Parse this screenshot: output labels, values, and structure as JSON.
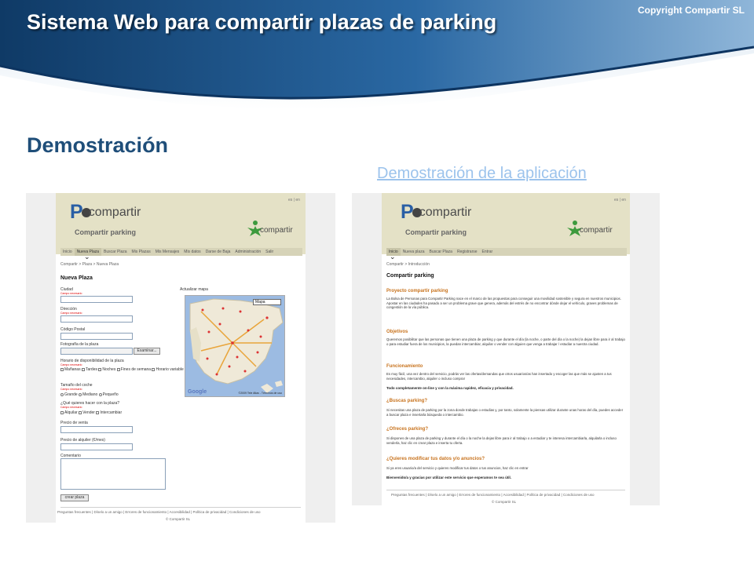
{
  "slide": {
    "title": "Sistema Web para compartir plazas de parking",
    "copyright": "Copyright Compartir SL",
    "section_title": "Demostración",
    "demo_link": "Demostración de la aplicación",
    "colors": {
      "header_dark": "#14416e",
      "header_mid": "#2d6aa4",
      "title_blue": "#1f4e79",
      "link": "#9cc3ec"
    }
  },
  "app": {
    "lang": "es | en",
    "logo_letter": "P",
    "logo_word": "compartir",
    "tagline": "Compartir parking",
    "brand_word": "compartir",
    "footer_links": "Preguntas frecuentes | Díselo a un amigo | Errores de funcionamiento | Accesibilidad | Política de privacidad | Condiciones de uso",
    "footer_copy": "© Compartir SL"
  },
  "left_screen": {
    "nav": [
      "Inicio",
      "Nueva Plaza",
      "Buscar Plaza",
      "Mis Plazas",
      "Mis Mensajes",
      "Mis datos",
      "Darse de Baja",
      "Administración",
      "Salir"
    ],
    "breadcrumb": "Compartir > Plaza > Nueva Plaza",
    "heading": "Nueva Plaza",
    "required": "Campo necesario",
    "fields": {
      "ciudad": "Ciudad",
      "direccion": "Dirección",
      "cp": "Código Postal",
      "foto": "Fotografía de la plaza",
      "examinar": "Examinar...",
      "horario": "Horario de disponibilidad de la plaza",
      "horario_opts": [
        "Mañanas",
        "Tardes",
        "Noches",
        "Fines de semana",
        "Horario variable"
      ],
      "tamano": "Tamaño del coche",
      "tamano_opts": [
        "Grande",
        "Mediano",
        "Pequeño"
      ],
      "que": "¿Qué quieres hacer con la plaza?",
      "que_opts": [
        "Alquilar",
        "Vender",
        "Intercambiar"
      ],
      "precio_venta": "Precio de venta",
      "precio_alquiler": "Precio de alquiler (€/mes)",
      "comentario": "Comentario",
      "submit": "crear plaza"
    },
    "map": {
      "label": "Actualizar mapa",
      "select": "Mapa",
      "google": "Google",
      "terms": "©2009 Tele Atlas - Términos de uso",
      "colors": {
        "sea": "#9cbbe2",
        "land": "#efe9d8",
        "roads": "#e9a53a"
      }
    }
  },
  "right_screen": {
    "nav": [
      "Inicio",
      "Nueva plaza",
      "Buscar Plaza",
      "Registrarse",
      "Entrar"
    ],
    "breadcrumb": "Compartir > Introducción",
    "heading": "Compartir parking",
    "sections": [
      {
        "title": "Proyecto compartir parking",
        "text": "La Bolsa de Personas para Compartir Parking nace en el marco de las propuestas para conseguir una movilidad sostenible y segura en nuestros municipios. Apostar en las ciudades ha pasado a ser un problema grave que genera, además del estrés de no encontrar dónde dejar el vehículo, graves problemas de congestión de la vía pública."
      },
      {
        "title": "Objetivos",
        "text": "Queremos posibilitar que las personas que tienen una plaza de parking y que durante el día (la noche, o parte del día o la noche) la dejan libre para ir al trabajo o para estudiar fuera de los municipios, la puedan intercambiar, alquilar o vender con alguien que venga a trabajar / estudiar a nuestra ciudad."
      },
      {
        "title": "Funcionamiento",
        "text": "Es muy fácil, una vez dentro del servicio, podrás ver las ofertas/demandas que otros usuarios/as han insertado y escoger las que más se ajusten a tus necesidades, intercambio, alquiler o incluso compra!",
        "bold": "Todo completamente on-line y con la máxima rapidez, eficacia y privacidad."
      },
      {
        "title": "¿Buscas parking?",
        "text": "Si necesitas una plaza de parking por la zona donde trabajas o estudias y, por tanto, solamente la piensas utilizar durante unas horas del día, puedes acceder a buscar plaza e insertarla búsqueda o intercambio."
      },
      {
        "title": "¿Ofreces parking?",
        "text": "Si dispones de una plaza de parking y durante el día o la noche la dejas libre para ir al trabajo o a estudiar y te interesa intercambiarla, alquilarla o incluso venderla, haz clic en crear plaza e inserta tu oferta."
      },
      {
        "title": "¿Quieres modificar tus datos y/o anuncios?",
        "text": "Si ya eres usuario/a del servicio y quieres modificar tus datos o tus anuncios, haz clic en entrar",
        "bold": "Bienvenido/a y gracias por utilizar este servicio que esperamos te sea útil."
      }
    ]
  }
}
